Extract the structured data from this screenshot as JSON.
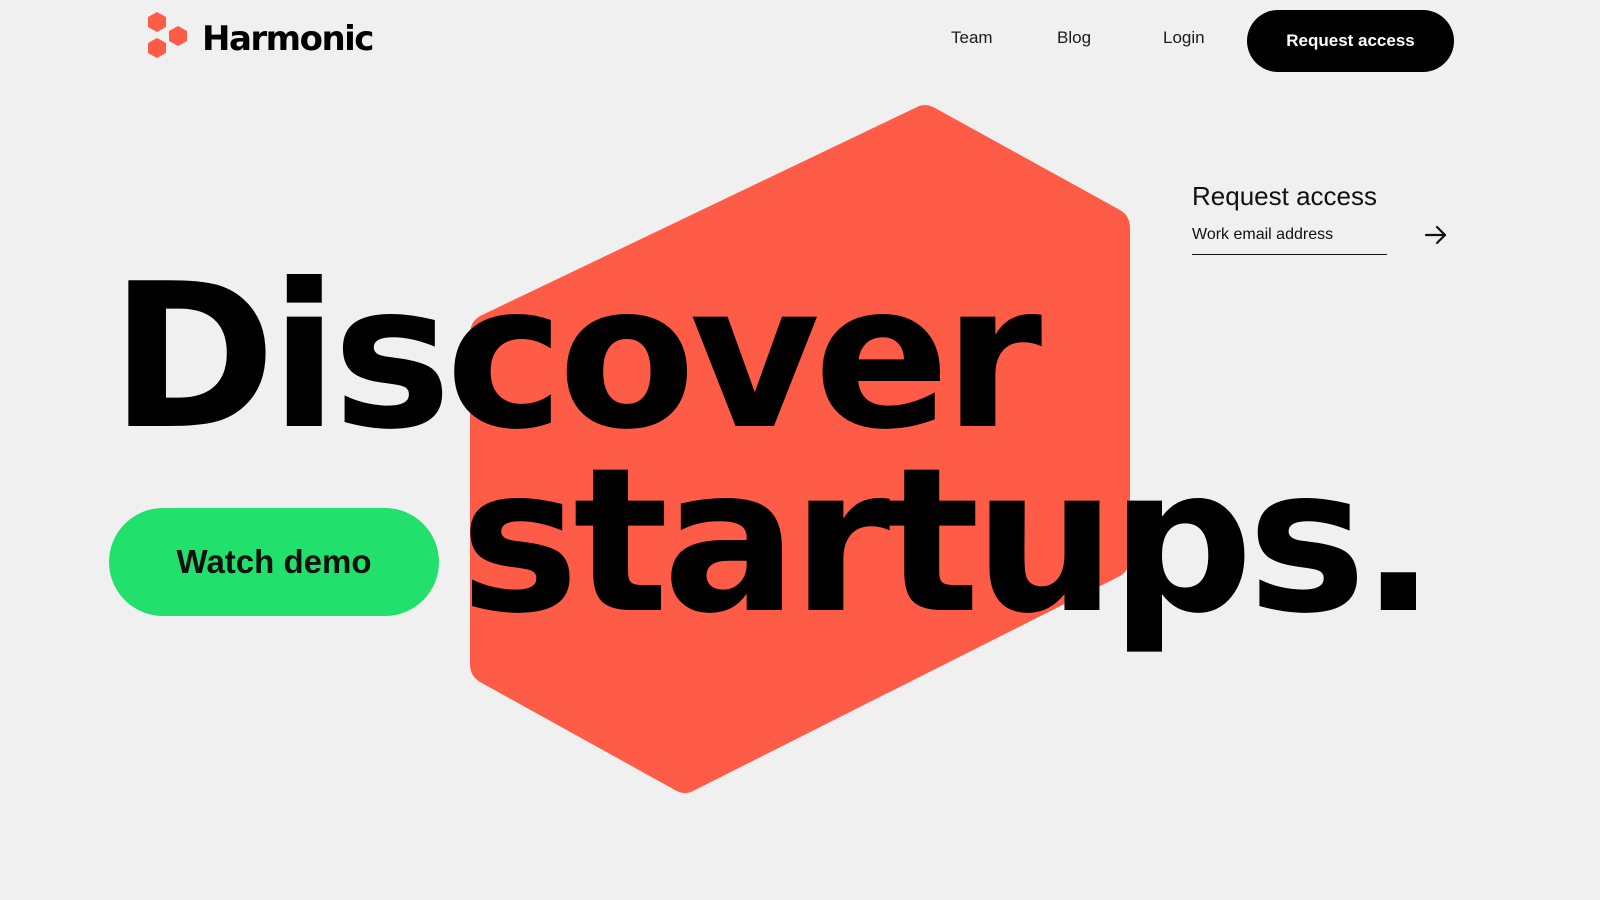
{
  "brand": {
    "name": "Harmonic",
    "logo_icon": "hexagon-cluster-icon",
    "accent_color": "#ff5c47"
  },
  "nav": {
    "items": [
      {
        "label": "Team"
      },
      {
        "label": "Blog"
      },
      {
        "label": "Login"
      }
    ],
    "cta_label": "Request access"
  },
  "signup": {
    "title": "Request access",
    "email_placeholder": "Work email address",
    "submit_icon": "arrow-right-icon"
  },
  "hero": {
    "headline_line1": "Discover",
    "headline_line2": "startups.",
    "watch_demo_label": "Watch demo",
    "watch_demo_color": "#21e06c"
  },
  "colors": {
    "background": "#f1f0f0",
    "hexagon": "#ff5c47",
    "text": "#000000",
    "cta_background": "#000000"
  }
}
